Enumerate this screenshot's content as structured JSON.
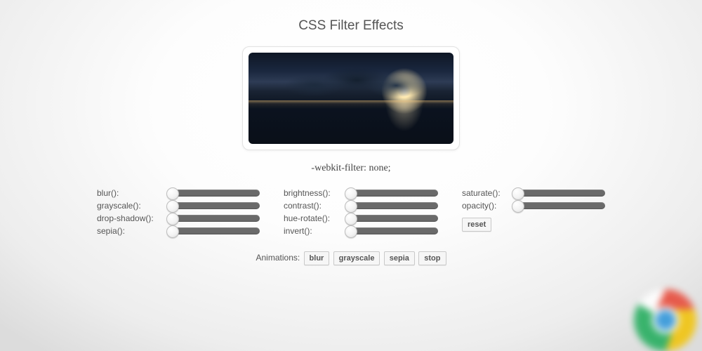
{
  "title": "CSS Filter Effects",
  "filter_output": "-webkit-filter: none;",
  "columns": {
    "col1": [
      {
        "label": "blur():"
      },
      {
        "label": "grayscale():"
      },
      {
        "label": "drop-shadow():"
      },
      {
        "label": "sepia():"
      }
    ],
    "col2": [
      {
        "label": "brightness():"
      },
      {
        "label": "contrast():"
      },
      {
        "label": "hue-rotate():"
      },
      {
        "label": "invert():"
      }
    ],
    "col3": [
      {
        "label": "saturate():"
      },
      {
        "label": "opacity():"
      }
    ]
  },
  "reset_label": "reset",
  "animations": {
    "label": "Animations:",
    "buttons": [
      "blur",
      "grayscale",
      "sepia",
      "stop"
    ]
  }
}
